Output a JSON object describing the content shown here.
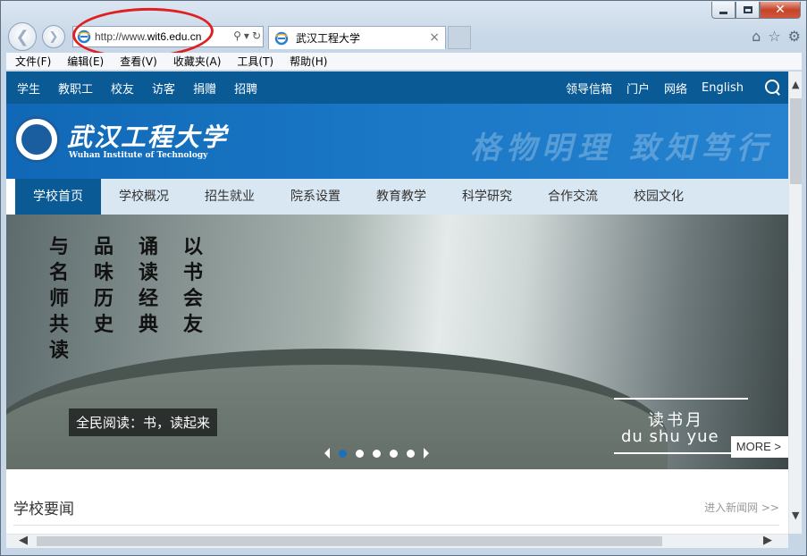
{
  "browser": {
    "url_prefix": "http://www.",
    "url_domain": "wit6.edu.cn",
    "tab_title": "武汉工程大学",
    "tab_close": "×",
    "back_glyph": "❮",
    "forward_glyph": "❯",
    "close_glyph": "✕",
    "search_glyph": "⚲",
    "dropdown_glyph": "▾",
    "refresh_glyph": "↻",
    "home_glyph": "⌂",
    "favorites_glyph": "☆",
    "tools_glyph": "⚙"
  },
  "menubar": [
    "文件(F)",
    "编辑(E)",
    "查看(V)",
    "收藏夹(A)",
    "工具(T)",
    "帮助(H)"
  ],
  "site": {
    "topbar_left": [
      "学生",
      "教职工",
      "校友",
      "访客",
      "捐赠",
      "招聘"
    ],
    "topbar_right": [
      "领导信箱",
      "门户",
      "网络",
      "English"
    ],
    "logo_cn": "武汉工程大学",
    "logo_en": "Wuhan Institute of Technology",
    "motto": "格物明理 致知笃行",
    "mainnav": [
      "学校首页",
      "学校概况",
      "招生就业",
      "院系设置",
      "教育教学",
      "科学研究",
      "合作交流",
      "校园文化"
    ],
    "banner": {
      "poem_cols": [
        [
          "与",
          "名",
          "师",
          "共",
          "读"
        ],
        [
          "品",
          "味",
          "历",
          "史"
        ],
        [
          "诵",
          "读",
          "经",
          "典"
        ],
        [
          "以",
          "书",
          "会",
          "友"
        ]
      ],
      "caption": "全民阅读：书，读起来",
      "title_cn": "读书月",
      "title_py": "du shu yue",
      "more": "MORE >"
    },
    "news": {
      "title": "学校要闻",
      "more": "进入新闻网 >>"
    }
  },
  "scroll": {
    "up": "▲",
    "down": "▼",
    "left": "◀",
    "right": "▶"
  }
}
